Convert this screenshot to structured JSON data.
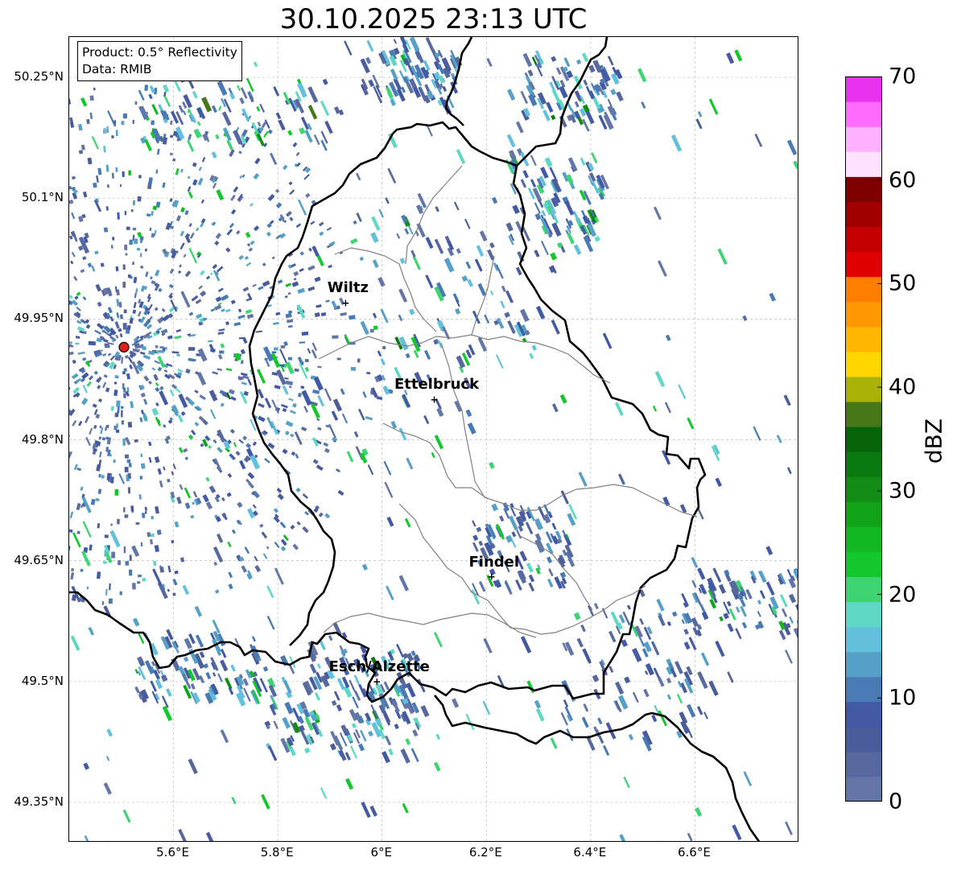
{
  "title": "30.10.2025 23:13 UTC",
  "info": {
    "product": "Product: 0.5° Reflectivity",
    "data": "Data: RMIB"
  },
  "lat_ticks": [
    "50.25°N",
    "50.1°N",
    "49.95°N",
    "49.8°N",
    "49.65°N",
    "49.5°N",
    "49.35°N"
  ],
  "lon_ticks": [
    "5.6°E",
    "5.8°E",
    "6°E",
    "6.2°E",
    "6.4°E",
    "6.6°E"
  ],
  "cities": [
    {
      "name": "Wiltz",
      "lon": 5.93,
      "lat": 49.97
    },
    {
      "name": "Ettelbruck",
      "lon": 6.1,
      "lat": 49.85
    },
    {
      "name": "Findel",
      "lon": 6.21,
      "lat": 49.63
    },
    {
      "name": "Esch/Alzette",
      "lon": 5.99,
      "lat": 49.5
    }
  ],
  "radar_site": {
    "lon": 5.505,
    "lat": 49.915,
    "color": "#e0201c"
  },
  "map_extent": {
    "lon_min": 5.4,
    "lon_max": 6.8,
    "lat_min": 49.3,
    "lat_max": 50.3
  },
  "colorbar": {
    "label": "dBZ",
    "ticks": [
      "0",
      "10",
      "20",
      "30",
      "40",
      "50",
      "60",
      "70"
    ],
    "min": 0,
    "max": 70,
    "colors": [
      "#6476a8",
      "#56689e",
      "#4a5c9c",
      "#425aa4",
      "#4a7ab4",
      "#56a0c8",
      "#62c0dc",
      "#5ed8c4",
      "#3fd472",
      "#12c82a",
      "#12b820",
      "#12a418",
      "#128c14",
      "#0a7a10",
      "#086408",
      "#46781a",
      "#aab208",
      "#ffd600",
      "#ffb600",
      "#ff9800",
      "#ff7e00",
      "#e00000",
      "#c40000",
      "#a00000",
      "#7e0000",
      "#ffe2ff",
      "#ffb2ff",
      "#ff6cff",
      "#e832f0"
    ]
  }
}
